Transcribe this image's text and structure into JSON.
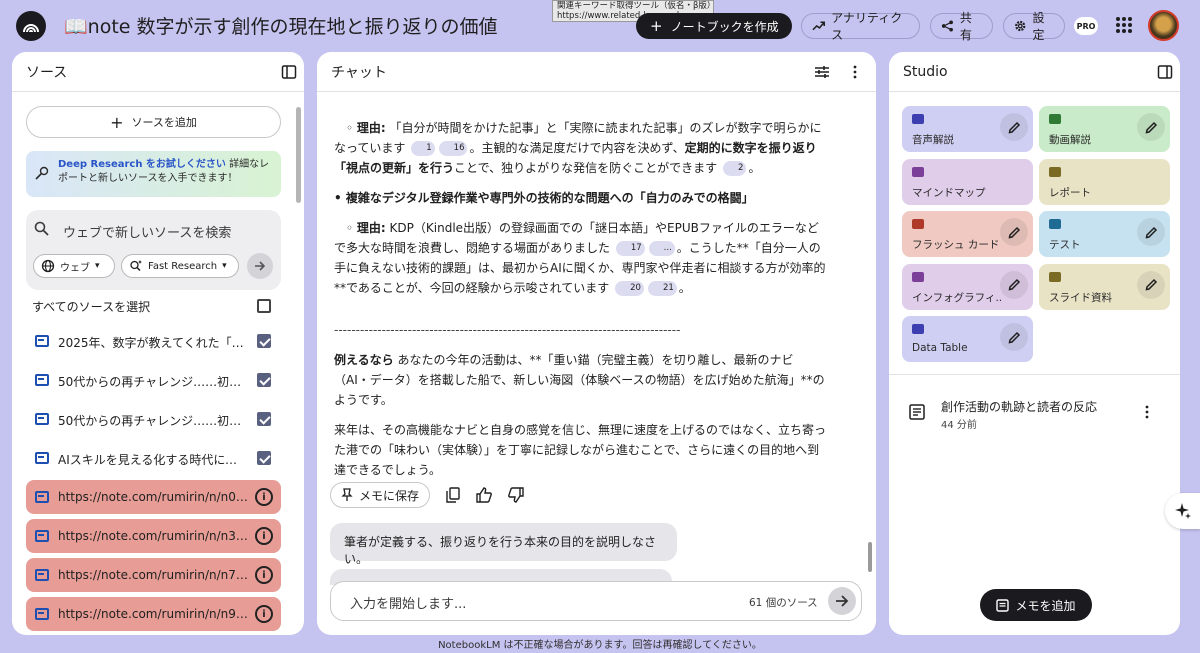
{
  "app": {
    "notebook_title": "📖note 数字が示す創作の現在地と振り返りの価値",
    "tooltip_line1": "関連キーワード取得ツール（仮名・β版）",
    "tooltip_line2": "https://www.related-keywords.com",
    "create_notebook": "ノートブックを作成",
    "analytics": "アナリティクス",
    "share": "共有",
    "settings": "設定",
    "pro_badge": "PRO"
  },
  "sources": {
    "title": "ソース",
    "add_source": "ソースを追加",
    "deep_research_link": "Deep Research をお試しください",
    "deep_research_text": " 詳細なレポートと新しいソースを入手できます！",
    "search_placeholder": "ウェブで新しいソースを検索",
    "chip_web": "ウェブ",
    "chip_research": "Fast Research",
    "select_all": "すべてのソースを選択",
    "items": [
      {
        "label": "2025年、数字が教えてくれた「私...",
        "checked": true,
        "state": "normal"
      },
      {
        "label": "50代からの再チャレンジ……初めて...",
        "checked": true,
        "state": "normal"
      },
      {
        "label": "50代からの再チャレンジ……初めて...",
        "checked": true,
        "state": "normal"
      },
      {
        "label": "AIスキルを見える化する時代に、私...",
        "checked": true,
        "state": "normal"
      },
      {
        "label": "https://note.com/rumirin/n/n09c05...",
        "checked": false,
        "state": "error"
      },
      {
        "label": "https://note.com/rumirin/n/n3e35c...",
        "checked": false,
        "state": "error"
      },
      {
        "label": "https://note.com/rumirin/n/n7beb5...",
        "checked": false,
        "state": "error"
      },
      {
        "label": "https://note.com/rumirin/n/n9d83fa...",
        "checked": false,
        "state": "error"
      }
    ]
  },
  "chat": {
    "title": "チャット",
    "p1_a": "理由:",
    "p1_b": "「自分が時間をかけた記事」と「実際に読まれた記事」のズレが数字で明らかになっています",
    "p1_cites": [
      "1",
      "16"
    ],
    "p1_c": "。主観的な満足度だけで内容を決めず、",
    "p1_d": "定期的に数字を振り返り「視点の更新」を行う",
    "p1_e": "ことで、独りよがりな発信を防ぐことができます",
    "p1_cite2": "2",
    "heading2": "複雑なデジタル登録作業や専門外の技術的な問題への「自力のみでの格闘」",
    "p2_a": "理由:",
    "p2_b": "KDP（Kindle出版）の登録画面での「謎日本語」やEPUBファイルのエラーなどで多大な時間を浪費し、悶絶する場面がありました",
    "p2_cites": [
      "17",
      "..."
    ],
    "p2_c": "。こうした**「自分一人の手に負えない技術的課題」は、最初からAIに聞くか、専門家や伴走者に相談する方が効率的**であることが、今回の経験から示唆されています",
    "p2_cites2": [
      "20",
      "21"
    ],
    "separator": "--------------------------------------------------------------------------------",
    "p3_a": "例えるなら",
    "p3_b": " あなたの今年の活動は、**「重い錨（完璧主義）を切り離し、最新のナビ（AI・データ）を搭載した船で、新しい海図（体験ベースの物語）を広げ始めた航海」**のようです。",
    "p4": "来年は、その高機能なナビと自身の感覚を信じ、無理に速度を上げるのではなく、立ち寄った港での「味わい（実体験）」を丁寧に記録しながら進むことで、さらに遠くの目的地へ到達できるでしょう。",
    "save_memo": "メモに保存",
    "suggestion": "筆者が定義する、振り返りを行う本来の目的を説明しなさい。",
    "input_placeholder": "入力を開始します...",
    "source_count": "61 個のソース"
  },
  "studio": {
    "title": "Studio",
    "tiles": [
      {
        "label": "音声解説",
        "bg": "#cfcff3",
        "icon_color": "#3d3fb0",
        "edit": true
      },
      {
        "label": "動画解説",
        "bg": "#c9ebc9",
        "icon_color": "#2f7a35",
        "edit": true
      },
      {
        "label": "マインドマップ",
        "bg": "#e0cde9",
        "icon_color": "#7b3f99",
        "edit": false
      },
      {
        "label": "レポート",
        "bg": "#e9e3c6",
        "icon_color": "#7a6a24",
        "edit": false
      },
      {
        "label": "フラッシュ カード",
        "bg": "#efc9c2",
        "icon_color": "#b03a2a",
        "edit": true
      },
      {
        "label": "テスト",
        "bg": "#c6e2f0",
        "icon_color": "#1e6b93",
        "edit": true
      },
      {
        "label": "インフォグラフィ...",
        "bg": "#e0cde9",
        "icon_color": "#7b3f99",
        "edit": true
      },
      {
        "label": "スライド資料",
        "bg": "#e9e3c6",
        "icon_color": "#7a6a24",
        "edit": true
      },
      {
        "label": "Data Table",
        "bg": "#cfcff3",
        "icon_color": "#3d3fb0",
        "edit": true
      }
    ],
    "note_title": "創作活動の軌跡と読者の反応",
    "note_time": "44 分前",
    "add_memo": "メモを追加"
  },
  "footer": "NotebookLM は不正確な場合があります。回答は再確認してください。"
}
